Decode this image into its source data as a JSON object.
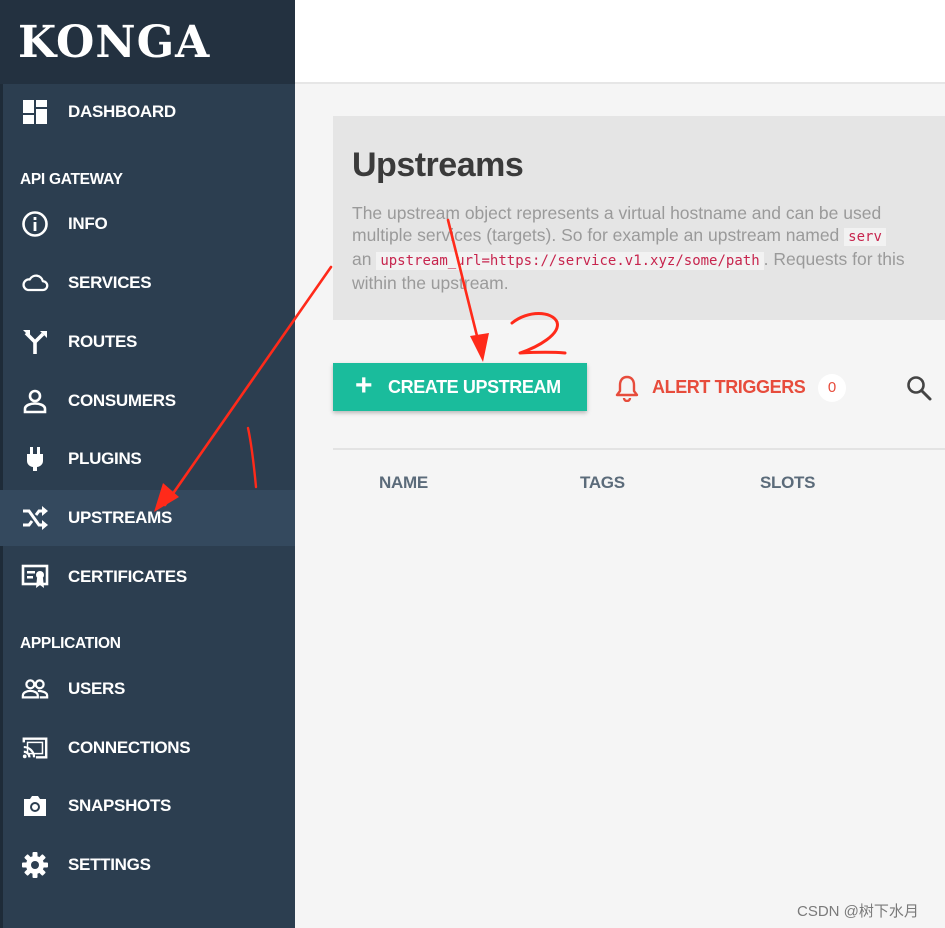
{
  "app": {
    "logo": "KONGA"
  },
  "sidebar": {
    "dashboard": {
      "label": "DASHBOARD",
      "icon": "dashboard-icon"
    },
    "sections": [
      {
        "title": "API GATEWAY"
      },
      {
        "title": "APPLICATION"
      }
    ],
    "items": [
      {
        "label": "INFO",
        "icon": "info-icon"
      },
      {
        "label": "SERVICES",
        "icon": "cloud-icon"
      },
      {
        "label": "ROUTES",
        "icon": "routes-icon"
      },
      {
        "label": "CONSUMERS",
        "icon": "person-icon"
      },
      {
        "label": "PLUGINS",
        "icon": "plug-icon"
      },
      {
        "label": "UPSTREAMS",
        "icon": "shuffle-icon",
        "active": true
      },
      {
        "label": "CERTIFICATES",
        "icon": "certificate-icon"
      },
      {
        "label": "USERS",
        "icon": "users-icon"
      },
      {
        "label": "CONNECTIONS",
        "icon": "cast-icon"
      },
      {
        "label": "SNAPSHOTS",
        "icon": "camera-icon"
      },
      {
        "label": "SETTINGS",
        "icon": "gear-icon"
      }
    ]
  },
  "main": {
    "title": "Upstreams",
    "description": {
      "line1": "The upstream object represents a virtual hostname and can be used",
      "line2_text": "multiple services (targets). So for example an upstream named ",
      "line2_code": "serv",
      "line3_text_before": "an ",
      "line3_code": "upstream_url=https://service.v1.xyz/some/path",
      "line3_text_after": ". Requests for this",
      "line4": "within the upstream."
    },
    "create_button": {
      "label": "CREATE UPSTREAM",
      "plus": "+"
    },
    "alert_triggers": {
      "label": "ALERT TRIGGERS",
      "count": "0"
    },
    "table": {
      "columns": [
        "NAME",
        "TAGS",
        "SLOTS"
      ]
    }
  },
  "annotations": {
    "step1": "1",
    "step2": "2"
  },
  "watermark": "CSDN @树下水月",
  "colors": {
    "sidebar_bg": "#2c3e50",
    "sidebar_active": "#34495e",
    "primary_button": "#1abc9c",
    "alert": "#e74c3c",
    "annotation": "#ff2a1a"
  }
}
